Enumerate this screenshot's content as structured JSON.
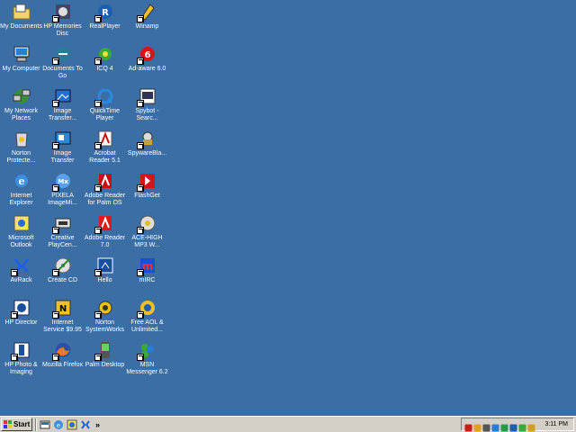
{
  "desktop": {
    "columns": [
      [
        {
          "label": "My Documents",
          "icon": "folder-documents-icon",
          "shortcut": false
        },
        {
          "label": "My Computer",
          "icon": "computer-icon",
          "shortcut": false
        },
        {
          "label": "My Network Places",
          "icon": "network-places-icon",
          "shortcut": false
        },
        {
          "label": "Norton Protecte...",
          "icon": "norton-protected-recycle-bin-icon",
          "shortcut": false
        },
        {
          "label": "Internet Explorer",
          "icon": "internet-explorer-icon",
          "shortcut": false
        },
        {
          "label": "Microsoft Outlook",
          "icon": "outlook-icon",
          "shortcut": false
        },
        {
          "label": "AvRack",
          "icon": "avrack-icon",
          "shortcut": true
        },
        {
          "label": "HP Director",
          "icon": "hp-director-icon",
          "shortcut": true
        },
        {
          "label": "HP Photo & Imaging",
          "icon": "hp-photo-imaging-icon",
          "shortcut": true
        }
      ],
      [
        {
          "label": "HP Memories Disc",
          "icon": "hp-memories-disc-icon",
          "shortcut": true
        },
        {
          "label": "Documents To Go",
          "icon": "documents-to-go-icon",
          "shortcut": true
        },
        {
          "label": "Image Transfer...",
          "icon": "image-transfer-icon",
          "shortcut": true
        },
        {
          "label": "Image Transfer",
          "icon": "image-transfer-2-icon",
          "shortcut": true
        },
        {
          "label": "PIXELA ImageMi...",
          "icon": "pixela-imagemixer-icon",
          "shortcut": true
        },
        {
          "label": "Creative PlayCen...",
          "icon": "creative-playcenter-icon",
          "shortcut": true
        },
        {
          "label": "Create CD",
          "icon": "create-cd-icon",
          "shortcut": true
        },
        {
          "label": "Internet Service $9.95",
          "icon": "netscape-internet-service-icon",
          "shortcut": true
        },
        {
          "label": "Mozilla Firefox",
          "icon": "firefox-icon",
          "shortcut": true
        }
      ],
      [
        {
          "label": "RealPlayer",
          "icon": "realplayer-icon",
          "shortcut": true
        },
        {
          "label": "ICQ 4",
          "icon": "icq-icon",
          "shortcut": true
        },
        {
          "label": "QuickTime Player",
          "icon": "quicktime-icon",
          "shortcut": true
        },
        {
          "label": "Acrobat Reader 5.1",
          "icon": "acrobat-reader-icon",
          "shortcut": true
        },
        {
          "label": "Adobe Reader for Palm OS",
          "icon": "adobe-reader-palm-icon",
          "shortcut": true
        },
        {
          "label": "Adobe Reader 7.0",
          "icon": "adobe-reader-7-icon",
          "shortcut": true
        },
        {
          "label": "Hello",
          "icon": "hello-icon",
          "shortcut": true
        },
        {
          "label": "Norton SystemWorks",
          "icon": "norton-systemworks-icon",
          "shortcut": true
        },
        {
          "label": "Palm Desktop",
          "icon": "palm-desktop-icon",
          "shortcut": true
        }
      ],
      [
        {
          "label": "Winamp",
          "icon": "winamp-icon",
          "shortcut": true
        },
        {
          "label": "Ad-aware 6.0",
          "icon": "ad-aware-icon",
          "shortcut": true
        },
        {
          "label": "Spybot - Searc...",
          "icon": "spybot-icon",
          "shortcut": true
        },
        {
          "label": "SpywareBla...",
          "icon": "spywareblaster-icon",
          "shortcut": true
        },
        {
          "label": "FlashGet",
          "icon": "flashget-icon",
          "shortcut": true
        },
        {
          "label": "ACE-HIGH MP3 W...",
          "icon": "ace-high-mp3-icon",
          "shortcut": true
        },
        {
          "label": "mIRC",
          "icon": "mirc-icon",
          "shortcut": true
        },
        {
          "label": "Free AOL & Unlimited...",
          "icon": "aol-icon",
          "shortcut": true
        },
        {
          "label": "MSN Messenger 6.2",
          "icon": "msn-messenger-icon",
          "shortcut": true
        }
      ]
    ]
  },
  "taskbar": {
    "start_label": "Start",
    "quick_launch": [
      "show-desktop-icon",
      "internet-explorer-icon",
      "outlook-icon",
      "avrack-icon"
    ],
    "more_label": "»",
    "tray_icons": [
      "adobe-tray-icon",
      "antivirus-tray-icon",
      "speaker-tray-icon",
      "network-tray-icon",
      "palm-hotsync-tray-icon",
      "aol-tray-icon",
      "msn-tray-icon",
      "shield-tray-icon"
    ],
    "clock": "3:11 PM"
  },
  "colors": {
    "desktop_background": "#3a6ea5",
    "taskbar": "#d4d0c8"
  }
}
